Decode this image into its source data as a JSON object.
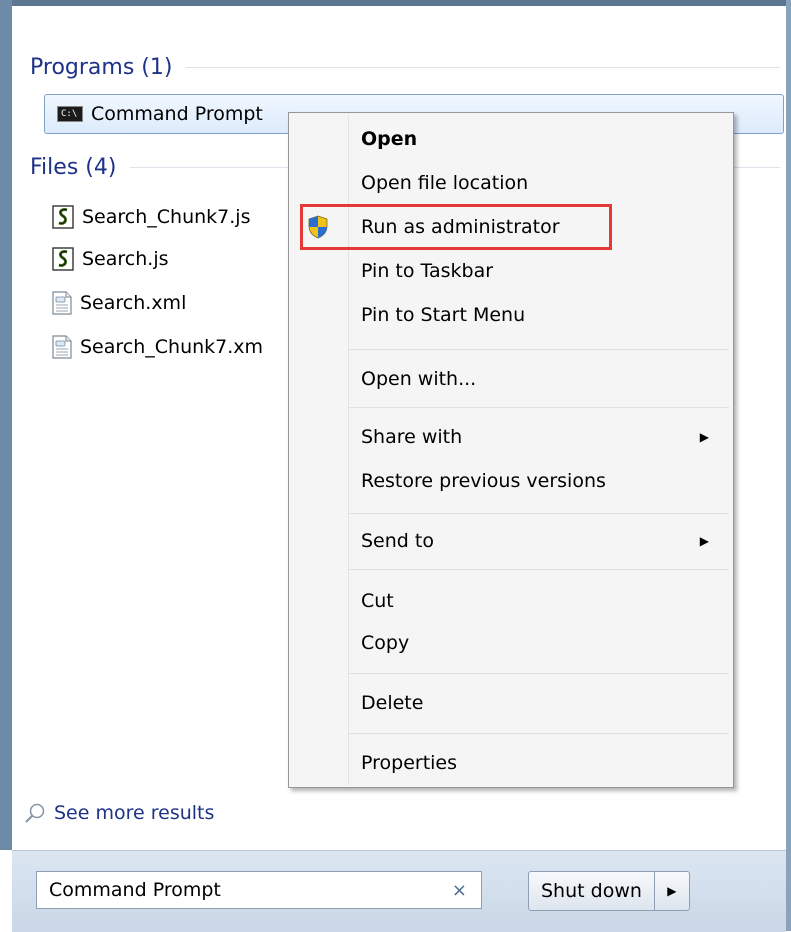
{
  "programs": {
    "heading": "Programs (1)",
    "items": [
      {
        "label": "Command Prompt",
        "icon": "command-prompt-icon"
      }
    ]
  },
  "files": {
    "heading": "Files (4)",
    "items": [
      {
        "label": "Search_Chunk7.js",
        "icon": "js-file-icon"
      },
      {
        "label": "Search.js",
        "icon": "js-file-icon"
      },
      {
        "label": "Search.xml",
        "icon": "xml-file-icon"
      },
      {
        "label": "Search_Chunk7.xm",
        "icon": "xml-file-icon"
      }
    ]
  },
  "see_more": {
    "label": "See more results",
    "icon": "search-icon"
  },
  "search": {
    "value": "Command Prompt",
    "clear": "×"
  },
  "shutdown": {
    "label": "Shut down",
    "arrow": "▶"
  },
  "context_menu": {
    "open": "Open",
    "open_file_location": "Open file location",
    "run_as_admin": "Run as administrator",
    "pin_taskbar": "Pin to Taskbar",
    "pin_start": "Pin to Start Menu",
    "open_with": "Open with...",
    "share_with": "Share with",
    "restore": "Restore previous versions",
    "send_to": "Send to",
    "cut": "Cut",
    "copy": "Copy",
    "delete": "Delete",
    "properties": "Properties",
    "submenu_arrow": "▶"
  },
  "colors": {
    "heading": "#1e3287",
    "highlight": "#e53935",
    "selection_border": "#7da2ce"
  }
}
